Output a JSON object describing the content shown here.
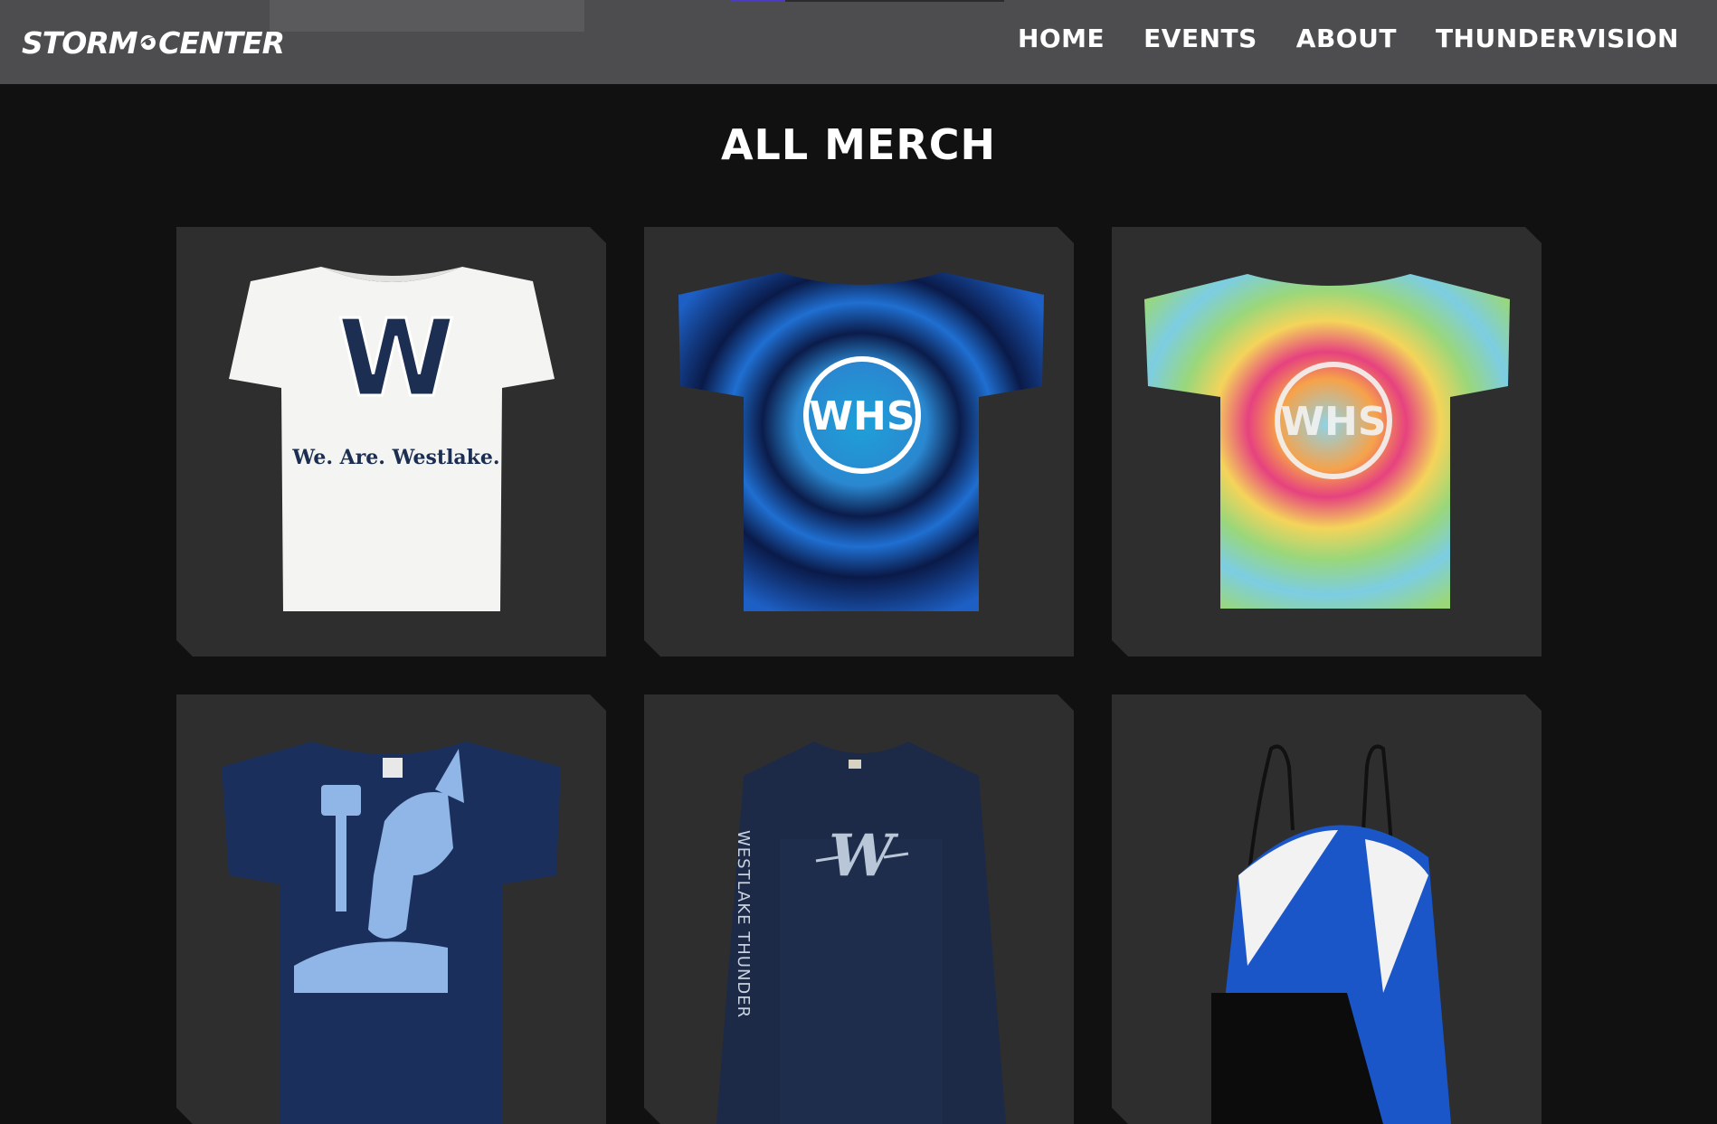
{
  "header": {
    "logo_text_left": "STORM",
    "logo_text_right": "CENTER",
    "nav": [
      "HOME",
      "EVENTS",
      "ABOUT",
      "THUNDERVISION"
    ]
  },
  "page": {
    "title": "ALL MERCH"
  },
  "products": [
    {
      "kind": "white-tshirt",
      "print_letter": "W",
      "print_text": "We. Are. Westlake."
    },
    {
      "kind": "blue-tiedye-tshirt",
      "print_text": "WHS"
    },
    {
      "kind": "rainbow-tiedye-tshirt",
      "print_text": "WHS"
    },
    {
      "kind": "navy-thunderbird-tshirt"
    },
    {
      "kind": "navy-longsleeve",
      "sleeve_text": "WESTLAKE THUNDER"
    },
    {
      "kind": "drawstring-bag"
    }
  ],
  "colors": {
    "background": "#111111",
    "header": "#4d4d4f",
    "card": "#2e2e2e",
    "accent": "#4b3cc5"
  }
}
